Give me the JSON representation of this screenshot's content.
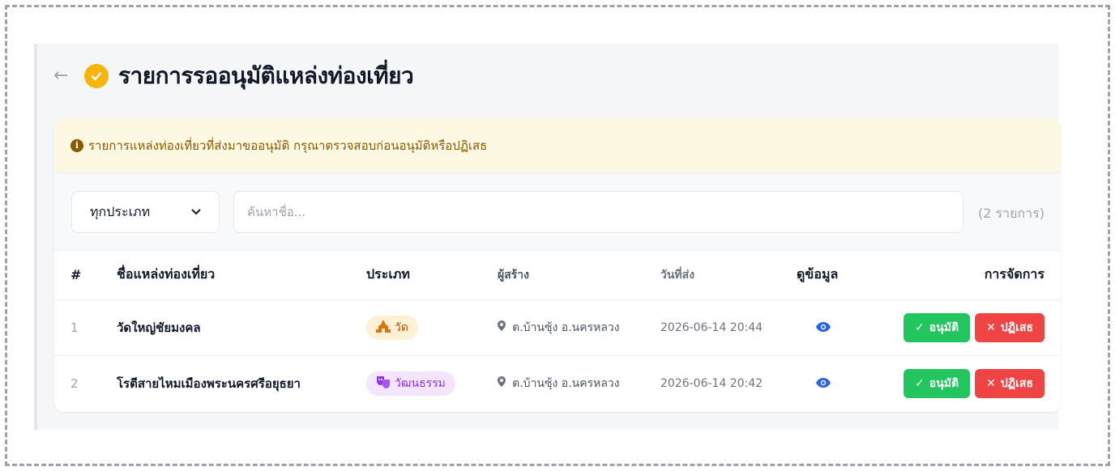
{
  "header": {
    "title": "รายการรออนุมัติแหล่งท่องเที่ยว"
  },
  "notice": {
    "text": "รายการแหล่งท่องเที่ยวที่ส่งมาขออนุมัติ กรุณาตรวจสอบก่อนอนุมัติหรือปฏิเสธ"
  },
  "filters": {
    "type_select_value": "ทุกประเภท",
    "search_placeholder": "ค้นหาชื่อ...",
    "search_value": "",
    "count_text": "(2 รายการ)"
  },
  "table": {
    "headers": {
      "num": "#",
      "name": "ชื่อแหล่งท่องเที่ยว",
      "type": "ประเภท",
      "creator": "ผู้สร้าง",
      "date": "วันที่ส่ง",
      "view": "ดูข้อมูล",
      "actions": "การจัดการ"
    },
    "rows": [
      {
        "num": "1",
        "name": "วัดใหญ่ชัยมงคล",
        "type": "วัด",
        "type_icon": "temple-icon",
        "creator": "ต.บ้านซุ้ง อ.นครหลวง",
        "date": "2026-06-14 20:44",
        "approve": "อนุมัติ",
        "reject": "ปฏิเสธ"
      },
      {
        "num": "2",
        "name": "โรตีสายไหมเมืองพระนครศรีอยุธยา",
        "type": "วัฒนธรรม",
        "type_icon": "theater-masks-icon",
        "creator": "ต.บ้านซุ้ง อ.นครหลวง",
        "date": "2026-06-14 20:42",
        "approve": "อนุมัติ",
        "reject": "ปฏิเสธ"
      }
    ]
  },
  "colors": {
    "accent_yellow": "#f5b50b",
    "approve_green": "#22c55e",
    "reject_red": "#ef4444",
    "view_blue": "#2563eb",
    "notice_bg": "#fdf8e1"
  }
}
